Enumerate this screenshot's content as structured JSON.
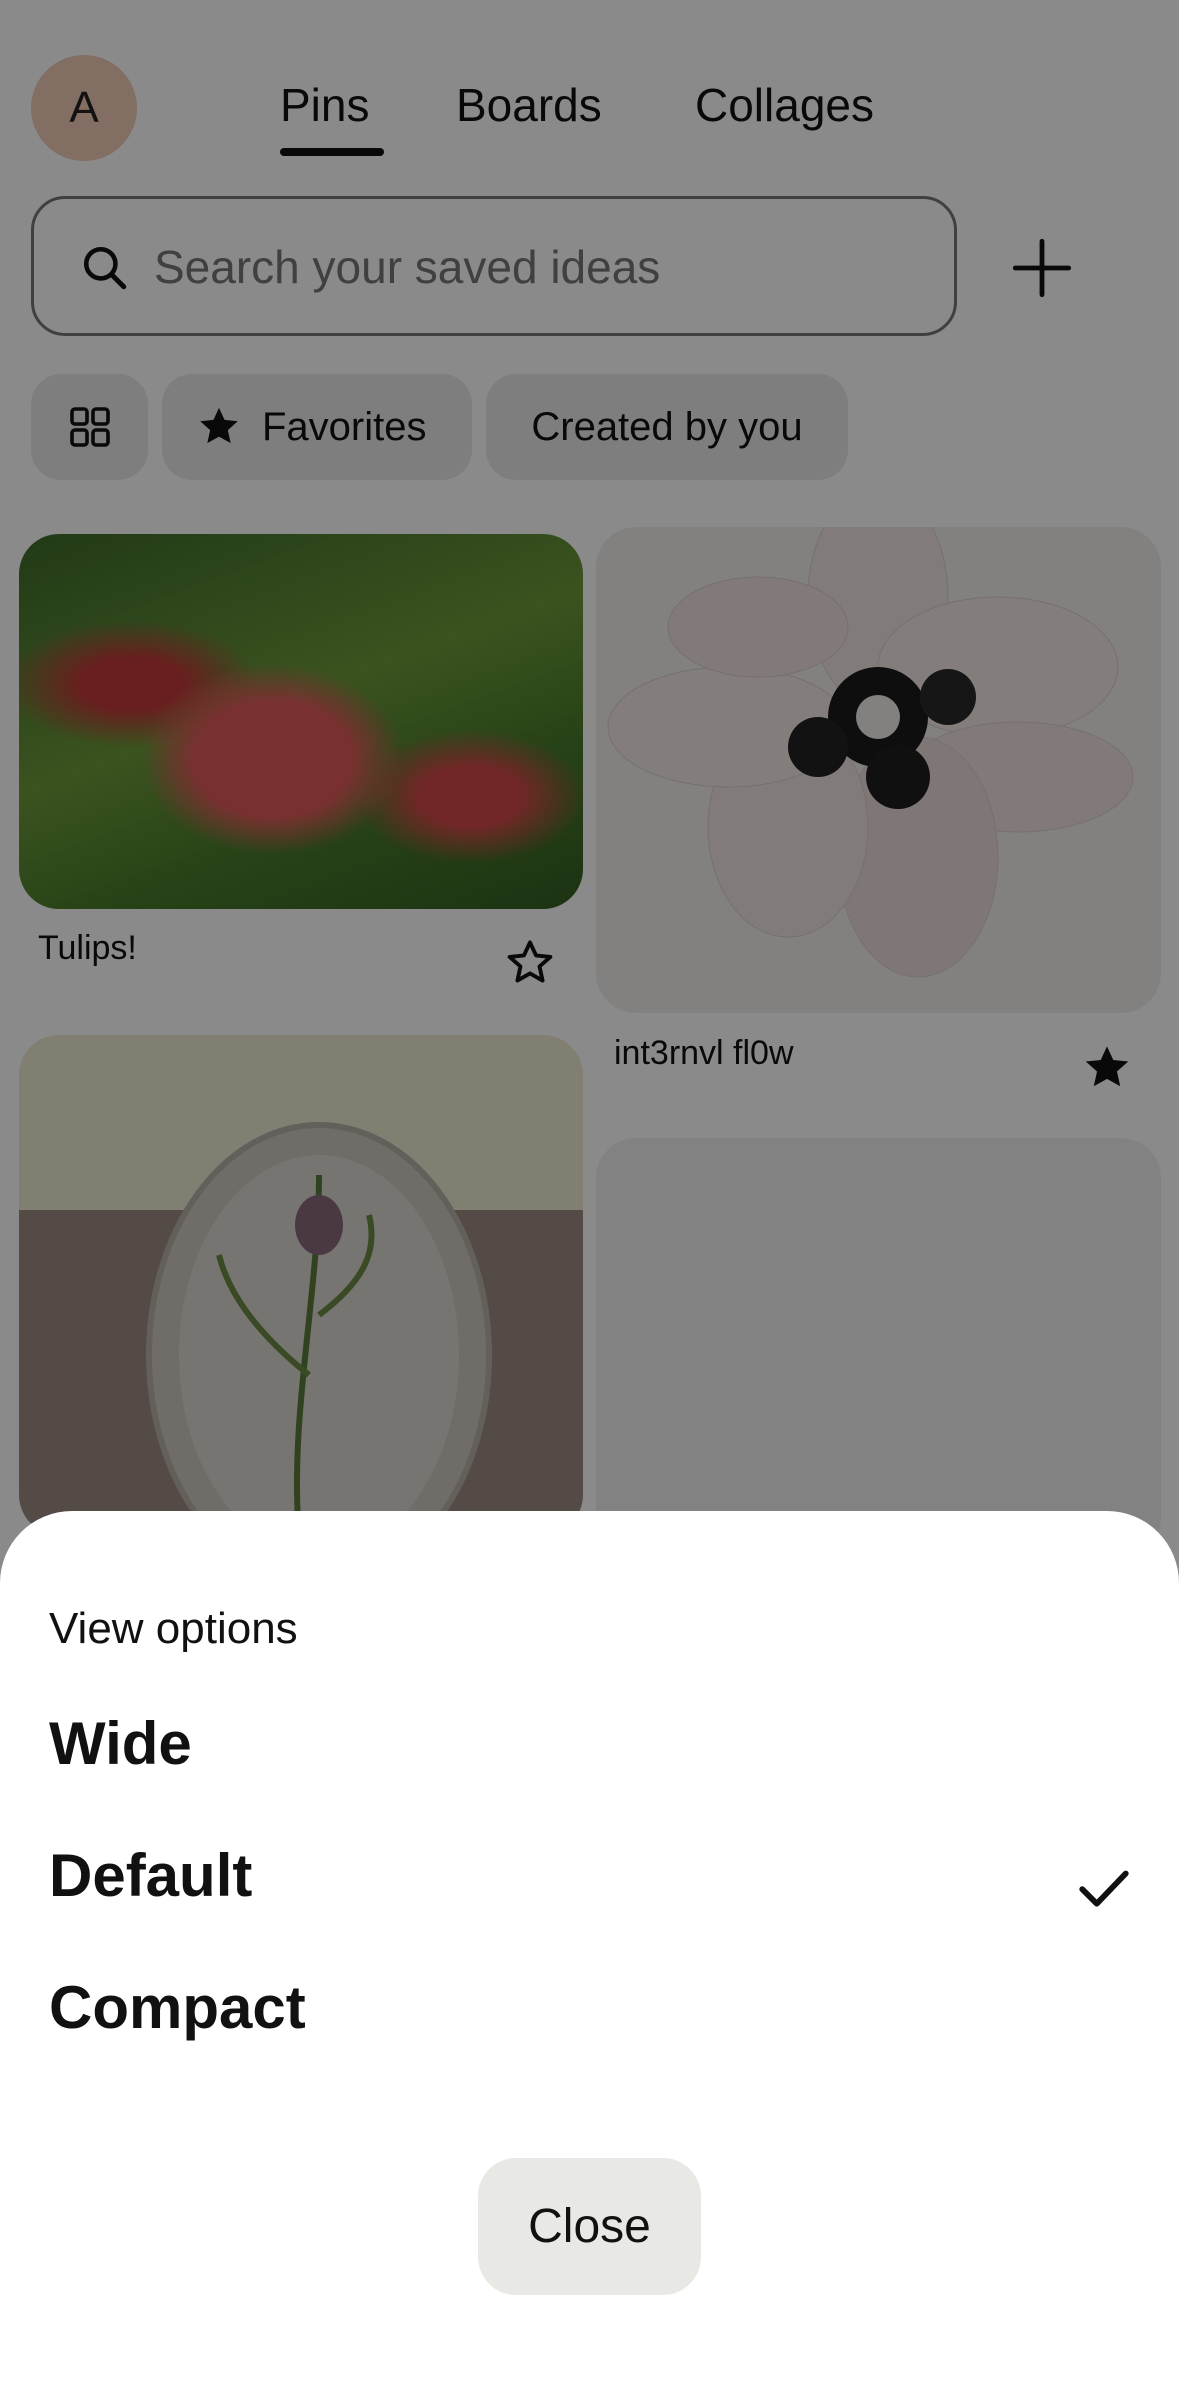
{
  "header": {
    "avatar_initial": "A",
    "tabs": [
      {
        "label": "Pins",
        "active": true
      },
      {
        "label": "Boards",
        "active": false
      },
      {
        "label": "Collages",
        "active": false
      }
    ]
  },
  "search": {
    "placeholder": "Search your saved ideas",
    "value": ""
  },
  "filters": {
    "favorites_label": "Favorites",
    "created_label": "Created by you"
  },
  "pins": [
    {
      "title": "Tulips!",
      "favorited": false
    },
    {
      "title": "int3rnvl fl0w",
      "favorited": true
    }
  ],
  "sheet": {
    "heading": "View options",
    "options": [
      {
        "label": "Wide",
        "selected": false
      },
      {
        "label": "Default",
        "selected": true
      },
      {
        "label": "Compact",
        "selected": false
      }
    ],
    "close_label": "Close"
  },
  "colors": {
    "scrim": "#000000",
    "chip_bg": "#e9e9e9",
    "avatar_bg": "#f1cbb8",
    "close_bg": "#e8e8e5"
  },
  "icons": [
    "search-icon",
    "plus-icon",
    "grid-icon",
    "star-icon",
    "star-outline-icon",
    "checkmark-icon"
  ]
}
